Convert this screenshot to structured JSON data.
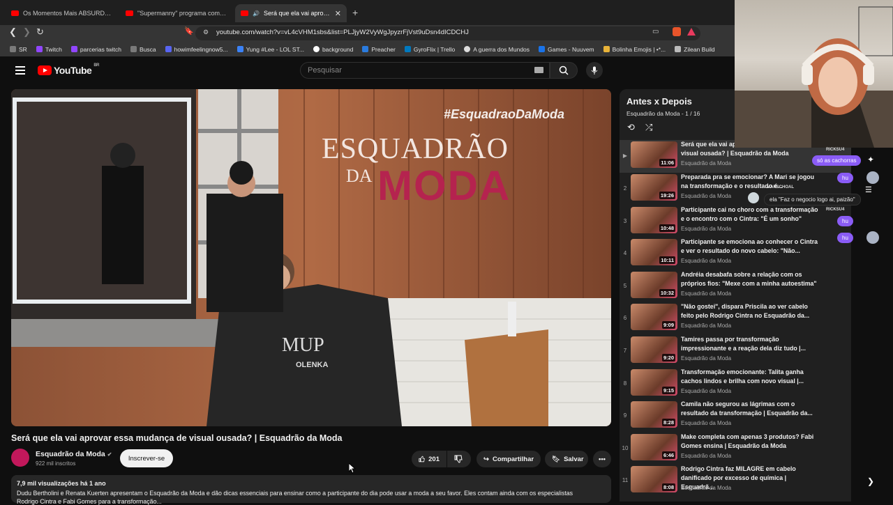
{
  "browser": {
    "tabs": [
      {
        "title": "Os Momentos Mais ABSURDOS do E",
        "active": false
      },
      {
        "title": "\"Supermanny\" programa completo -",
        "active": false
      },
      {
        "title": "Será que ela vai aprovar essa",
        "active": true
      }
    ],
    "url": "youtube.com/watch?v=vL4cVHM1sbs&list=PLJjyW2VyWgJpyzrFjVst9uDsn4dICDCHJ",
    "bookmarks": [
      "SR",
      "Twitch",
      "parcerias twitch",
      "Busca",
      "howimfeelingnow5...",
      "Yung #Lee - LOL ST...",
      "background",
      "Preacher",
      "GyroFlix | Trello",
      "A guerra dos Mundos",
      "Games - Nuuvem",
      "Bolinha Emojis | •*...",
      "Zilean Build"
    ]
  },
  "youtube": {
    "logo": "YouTube",
    "region": "BR",
    "search_placeholder": "Pesquisar"
  },
  "video": {
    "overlay_hashtag": "#EsquadraoDaModa",
    "sign_line1": "ESQUADRÃO",
    "sign_line2": "DA",
    "sign_line3": "MODA",
    "cape_brand": "MUP",
    "cape_brand2": "OLENKA",
    "title": "Será que ela vai aprovar essa mudança de visual ousada? | Esquadrão da Moda",
    "channel": "Esquadrão da Moda",
    "subscribers": "922 mil inscritos",
    "subscribe_label": "Inscrever-se",
    "likes": "201",
    "share_label": "Compartilhar",
    "save_label": "Salvar",
    "views_meta": "7,9 mil visualizações  há 1 ano",
    "description": "Dudu Bertholini e Renata Kuerten apresentam o Esquadrão da Moda e dão dicas essenciais para ensinar como a participante do dia pode usar a moda a seu favor. Eles contam ainda com os especialistas",
    "description_line2": "Rodrigo Cintra e Fabi Gomes para a transformação..."
  },
  "playlist": {
    "title": "Antes x Depois",
    "subtitle": "Esquadrão da Moda - 1 / 16",
    "items": [
      {
        "index": "▶",
        "title": "Será que ela vai aprovar essa mudança de visual ousada? | Esquadrão da Moda",
        "channel": "Esquadrão da Moda",
        "duration": "11:06"
      },
      {
        "index": "2",
        "title": "Preparada pra se emocionar? A Mari se jogou na transformação e o resultado é...",
        "channel": "Esquadrão da Moda",
        "duration": "19:26"
      },
      {
        "index": "3",
        "title": "Participante cai no choro com a transformação e o encontro com o Cintra: \"É um sonho\"",
        "channel": "Esquadrão da Moda",
        "duration": "10:48"
      },
      {
        "index": "4",
        "title": "Participante se emociona ao conhecer o Cintra e ver o resultado do novo cabelo: \"Não...",
        "channel": "Esquadrão da Moda",
        "duration": "10:11"
      },
      {
        "index": "5",
        "title": "Andréia desabafa sobre a relação com os próprios fios: \"Mexe com a minha autoestima\"",
        "channel": "Esquadrão da Moda",
        "duration": "10:32"
      },
      {
        "index": "6",
        "title": "\"Não gostei\", dispara Priscila ao ver cabelo feito pelo Rodrigo Cintra no Esquadrão da...",
        "channel": "Esquadrão da Moda",
        "duration": "9:09"
      },
      {
        "index": "7",
        "title": "Tamires passa por transformação impressionante e a reação dela diz tudo |...",
        "channel": "Esquadrão da Moda",
        "duration": "9:20"
      },
      {
        "index": "8",
        "title": "Transformação emocionante: Talita ganha cachos lindos e brilha com novo visual |...",
        "channel": "Esquadrão da Moda",
        "duration": "9:15"
      },
      {
        "index": "9",
        "title": "Camila não segurou as lágrimas com o resultado da transformação | Esquadrão da...",
        "channel": "Esquadrão da Moda",
        "duration": "8:28"
      },
      {
        "index": "10",
        "title": "Make completa com apenas 3 produtos? Fabi Gomes ensina | Esquadrão da Moda",
        "channel": "Esquadrão da Moda",
        "duration": "6:46"
      },
      {
        "index": "11",
        "title": "Rodrigo Cintra faz MILAGRE em cabelo danificado por excesso de química | Esquadrã...",
        "channel": "Esquadrão da Moda",
        "duration": "8:08"
      }
    ]
  },
  "stream_chat": {
    "user1": "RICKSU4",
    "msg1": "só as cachorras",
    "msg2": "hu",
    "user2": "MARSCHOAL",
    "msg3": "ela \"Faz o negocio logo ai, paizão\"",
    "user3": "RICKSU4",
    "msg4": "hu",
    "msg5": "hu"
  },
  "colors": {
    "yt_red": "#ff0000",
    "bg": "#0f0f0f",
    "chat_purple": "#8a5cf6"
  }
}
